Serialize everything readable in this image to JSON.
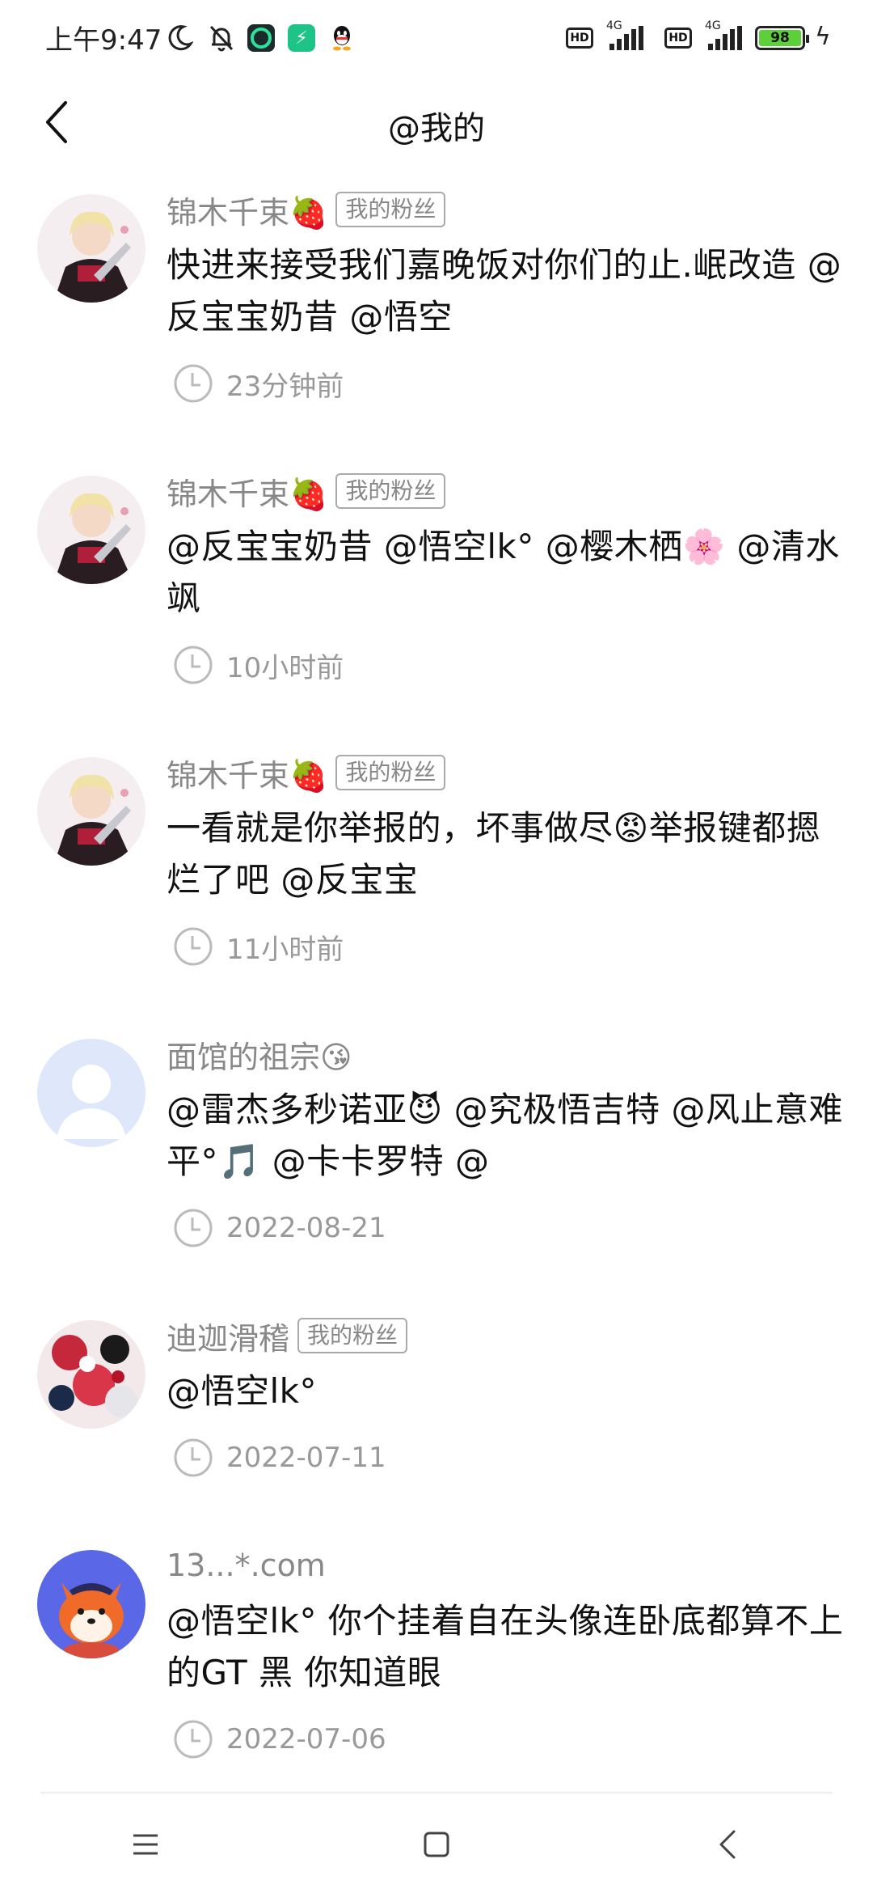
{
  "status": {
    "time": "上午9:47",
    "hd": "HD",
    "net": "4G",
    "battery": "98"
  },
  "header": {
    "title": "@我的"
  },
  "items": [
    {
      "name": "锦木千束🍓",
      "badge": "我的粉丝",
      "text": "快进来接受我们嘉晚饭对你们的止.岷改造 @反宝宝奶昔 @悟空",
      "time": "23分钟前",
      "avatar": "anime-girl"
    },
    {
      "name": "锦木千束🍓",
      "badge": "我的粉丝",
      "text": "@反宝宝奶昔 @悟空lk° @樱木栖🌸 @清水飒",
      "time": "10小时前",
      "avatar": "anime-girl"
    },
    {
      "name": "锦木千束🍓",
      "badge": "我的粉丝",
      "text": "一看就是你举报的，坏事做尽😡举报键都摁烂了吧 @反宝宝",
      "time": "11小时前",
      "avatar": "anime-girl"
    },
    {
      "name": "面馆的祖宗😘",
      "badge": "",
      "text": "@雷杰多秒诺亚😈 @究极悟吉特 @风止意难平°🎵 @卡卡罗特 @",
      "time": "2022-08-21",
      "avatar": "default-user"
    },
    {
      "name": "迪迦滑稽",
      "badge": "我的粉丝",
      "text": "@悟空lk°",
      "time": "2022-07-11",
      "avatar": "colorful"
    },
    {
      "name": "13...*.com",
      "badge": "",
      "text": " @悟空lk° 你个挂着自在头像连卧底都算不上的GT 黑 你知道眼",
      "time": "2022-07-06",
      "avatar": "fox"
    }
  ]
}
